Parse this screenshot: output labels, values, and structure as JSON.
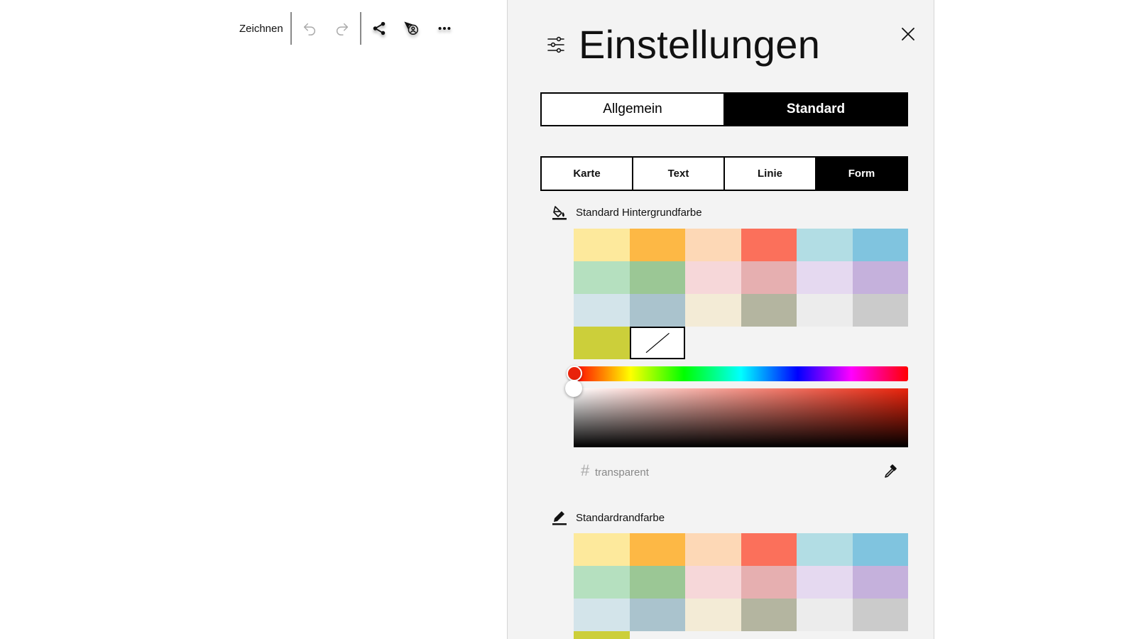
{
  "toolbar": {
    "draw_label": "Zeichnen",
    "icons": [
      "pen-icon",
      "undo-icon",
      "redo-icon",
      "share-icon",
      "presence-icon",
      "more-icon"
    ]
  },
  "settings": {
    "title": "Einstellungen",
    "tabs_main": [
      {
        "label": "Allgemein",
        "active": false
      },
      {
        "label": "Standard",
        "active": true
      }
    ],
    "tabs_sub": [
      {
        "label": "Karte",
        "active": false
      },
      {
        "label": "Text",
        "active": false
      },
      {
        "label": "Linie",
        "active": false
      },
      {
        "label": "Form",
        "active": true
      }
    ],
    "background_color": {
      "label": "Standard Hintergrundfarbe",
      "swatches": [
        "#fde99c",
        "#fdb845",
        "#fdd8b6",
        "#fb705b",
        "#b2dde4",
        "#80c4df",
        "#b5e0bf",
        "#9bc795",
        "#f6d7d9",
        "#e6afb0",
        "#e5d9f0",
        "#c5b1dc",
        "#d3e4ea",
        "#aac3cd",
        "#f3ebd6",
        "#b4b5a0",
        "#ececec",
        "#cbcbcb",
        "#cccf3a",
        "transparent"
      ],
      "selected": "transparent",
      "hex_value": "transparent",
      "hue_color": "#e9230b"
    },
    "border_color": {
      "label": "Standardrandfarbe",
      "swatches": [
        "#fde99c",
        "#fdb845",
        "#fdd8b6",
        "#fb705b",
        "#b2dde4",
        "#80c4df",
        "#b5e0bf",
        "#9bc795",
        "#f6d7d9",
        "#e6afb0",
        "#e5d9f0",
        "#c5b1dc",
        "#d3e4ea",
        "#aac3cd",
        "#f3ebd6",
        "#b4b5a0",
        "#ececec",
        "#cbcbcb",
        "#cccf3a"
      ]
    }
  }
}
